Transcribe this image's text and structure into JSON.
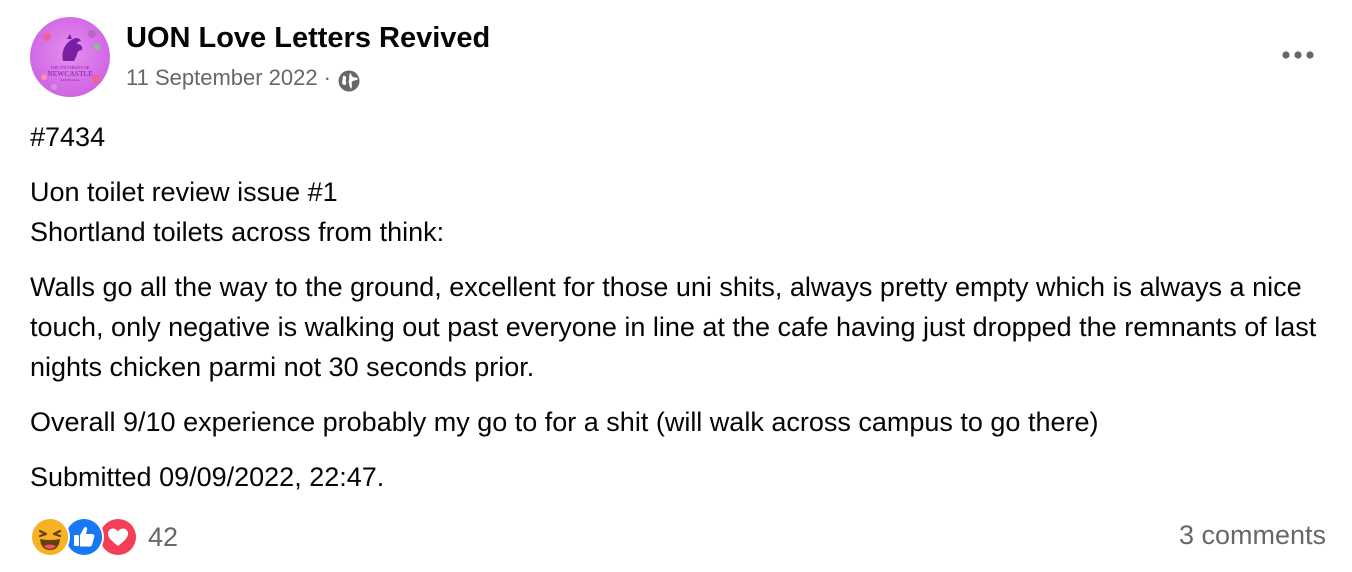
{
  "page": {
    "name": "UON Love Letters Revived",
    "date": "11 September 2022",
    "separator": "·",
    "privacy_icon": "globe-icon",
    "avatar_text_top": "THE UNIVERSITY OF",
    "avatar_text_main": "NEWCASTLE",
    "avatar_text_bottom": "AUSTRALIA"
  },
  "post": {
    "paragraphs": [
      "#7434",
      "Uon toilet review issue #1\nShortland toilets across from think:",
      "Walls go all the way to the ground, excellent for those uni shits, always pretty empty which is always a nice touch, only negative is walking out past everyone in line at the cafe having just dropped the remnants of last nights chicken parmi not 30 seconds prior.",
      "Overall 9/10 experience probably my go to for a shit (will walk across campus to go there)",
      "Submitted 09/09/2022, 22:47."
    ]
  },
  "footer": {
    "reaction_icons": [
      "haha-icon",
      "like-icon",
      "love-icon"
    ],
    "reaction_count": "42",
    "comments_label": "3 comments"
  },
  "colors": {
    "text": "#050505",
    "secondary": "#65676b",
    "like": "#1877f2",
    "love": "#f33e58",
    "haha": "#f7b125",
    "avatar": "#d46be6"
  }
}
